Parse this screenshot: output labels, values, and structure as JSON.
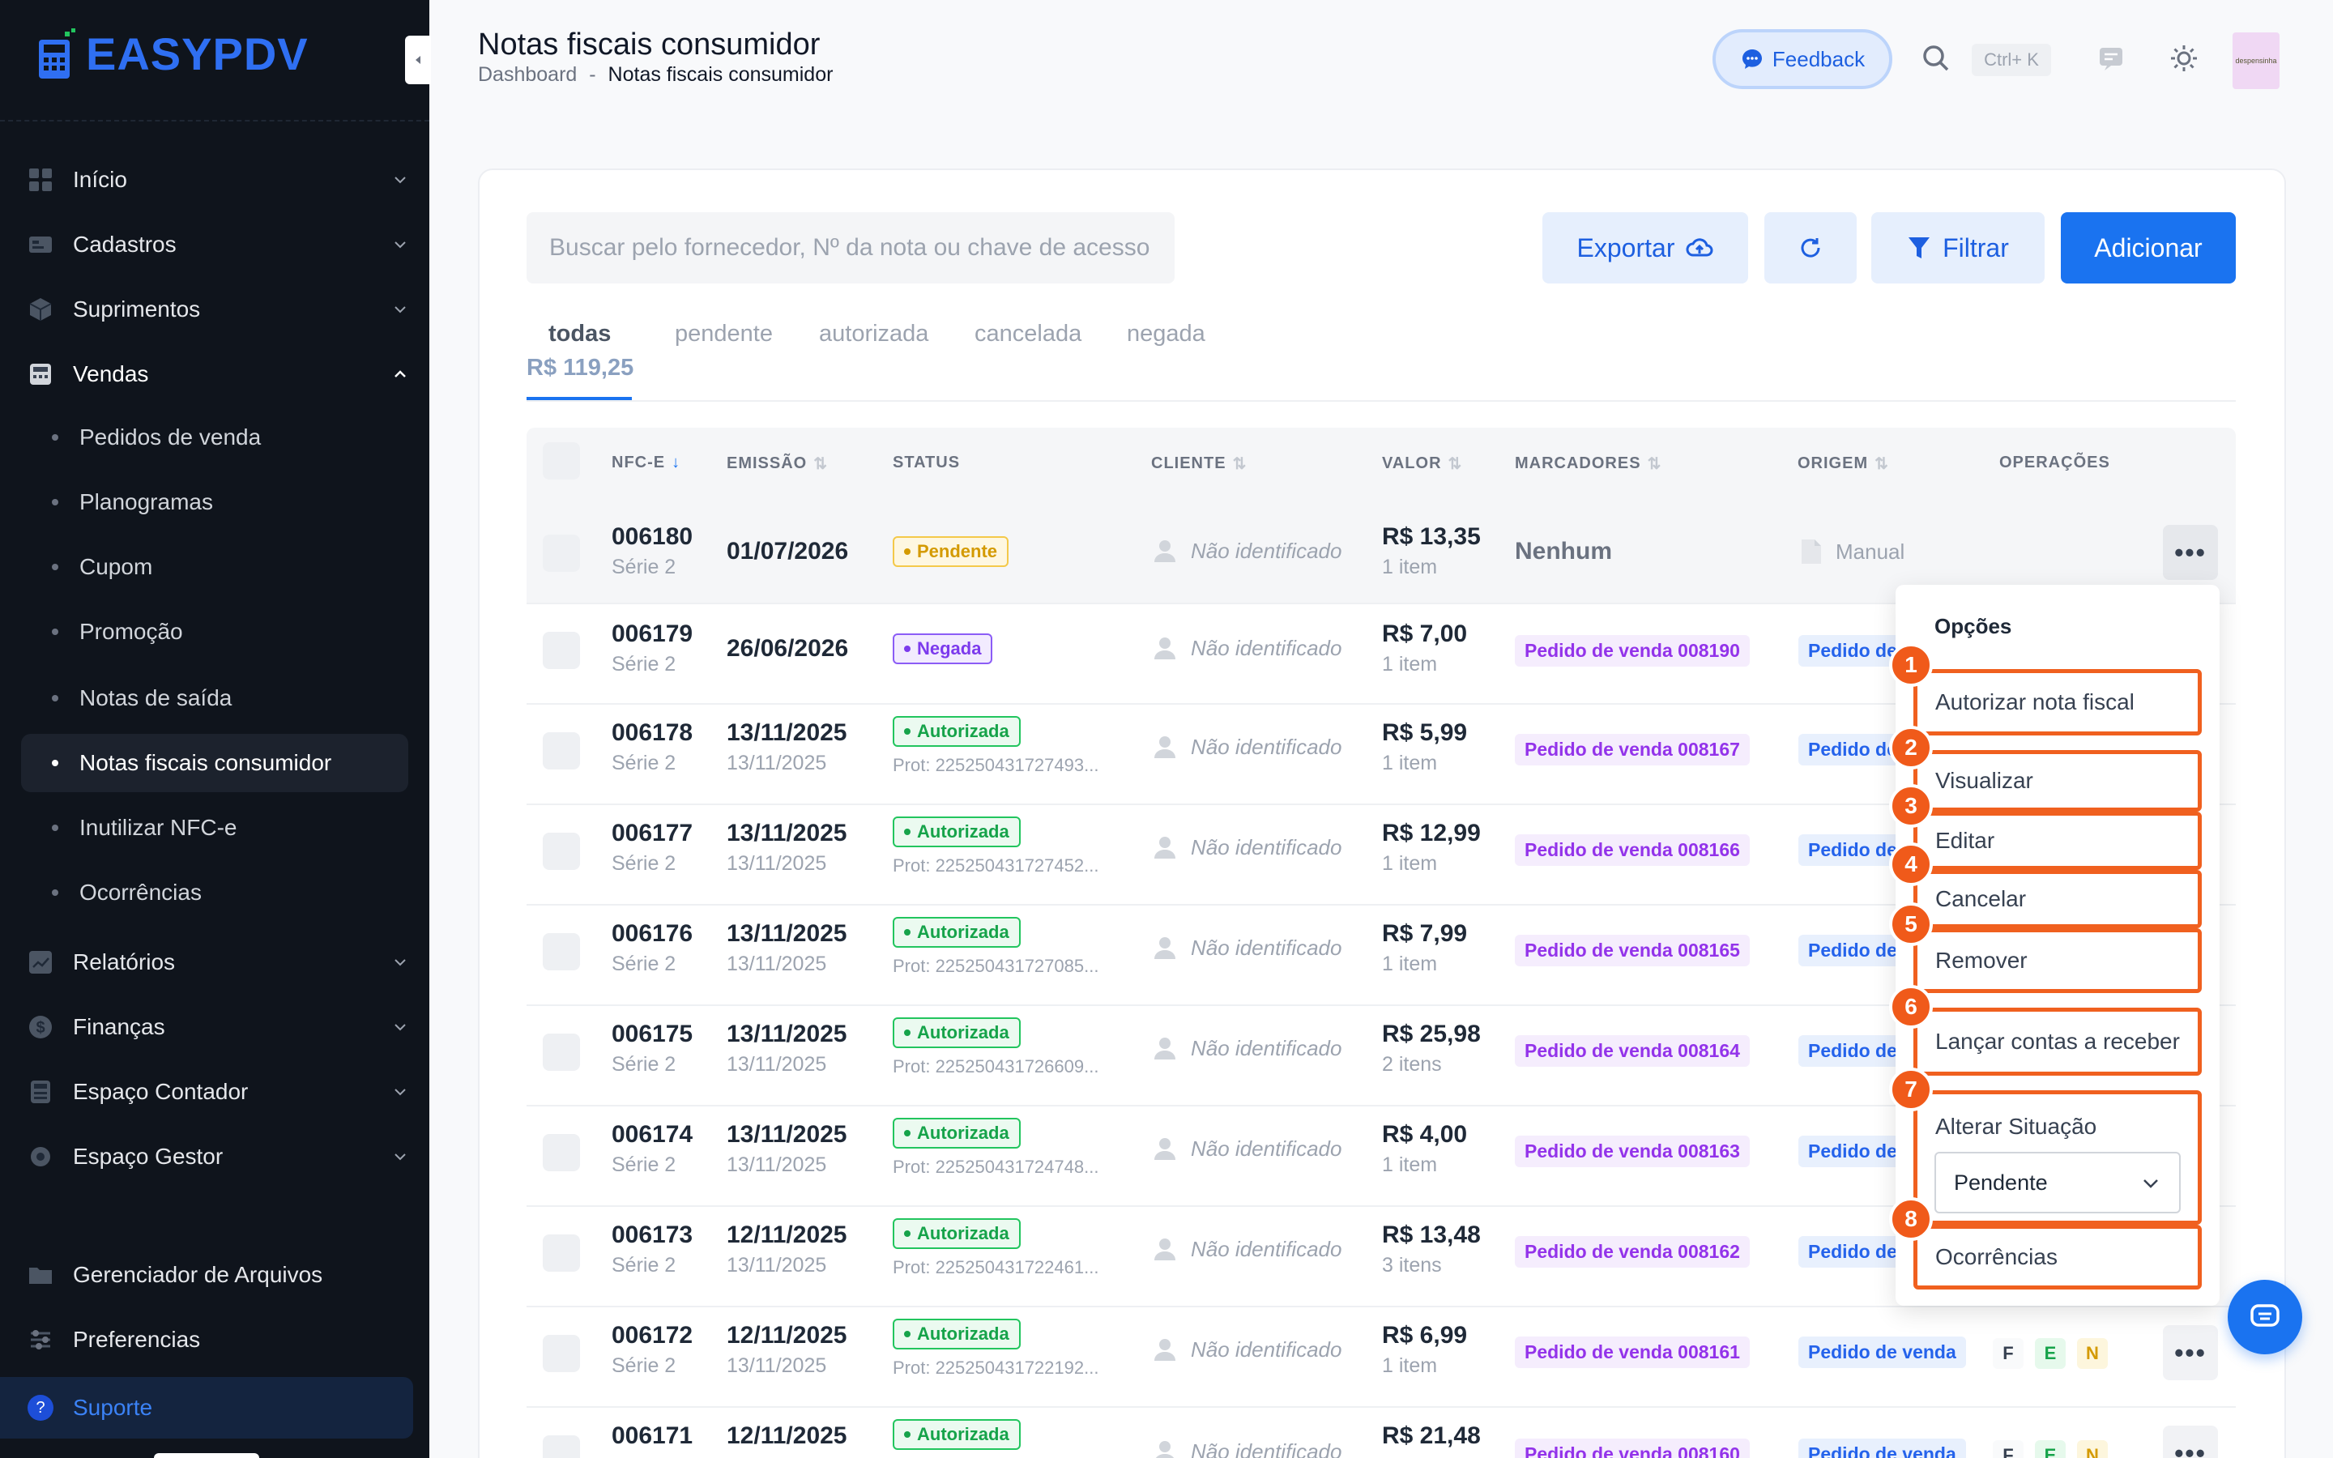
{
  "sidebar": {
    "logo_text": "EASYPDV",
    "items": [
      {
        "label": "Início",
        "icon": "home-icon"
      },
      {
        "label": "Cadastros",
        "icon": "id-card-icon"
      },
      {
        "label": "Suprimentos",
        "icon": "box-icon"
      },
      {
        "label": "Vendas",
        "icon": "register-icon"
      },
      {
        "label": "Relatórios",
        "icon": "chart-icon"
      },
      {
        "label": "Finanças",
        "icon": "dollar-icon"
      },
      {
        "label": "Espaço Contador",
        "icon": "calculator-icon"
      },
      {
        "label": "Espaço Gestor",
        "icon": "gear-icon"
      },
      {
        "label": "Gerenciador de Arquivos",
        "icon": "folder-icon"
      },
      {
        "label": "Preferencias",
        "icon": "sliders-icon"
      },
      {
        "label": "Suporte",
        "icon": "help-icon"
      }
    ],
    "sub_items": [
      "Pedidos de venda",
      "Planogramas",
      "Cupom",
      "Promoção",
      "Notas de saída",
      "Notas fiscais consumidor",
      "Inutilizar NFC-e",
      "Ocorrências"
    ]
  },
  "header": {
    "title": "Notas fiscais consumidor",
    "breadcrumb_root": "Dashboard",
    "breadcrumb_sep": "-",
    "breadcrumb_current": "Notas fiscais consumidor",
    "feedback_label": "Feedback",
    "shortcut": "Ctrl+ K",
    "avatar_text": "despensinha"
  },
  "toolbar": {
    "search_placeholder": "Buscar pelo fornecedor, Nº da nota ou chave de acesso",
    "export_label": "Exportar",
    "filter_label": "Filtrar",
    "add_label": "Adicionar"
  },
  "tabs": [
    {
      "label": "todas",
      "sum": "R$ 119,25"
    },
    {
      "label": "pendente"
    },
    {
      "label": "autorizada"
    },
    {
      "label": "cancelada"
    },
    {
      "label": "negada"
    }
  ],
  "columns": [
    "NFC-E",
    "EMISSÃO",
    "STATUS",
    "CLIENTE",
    "VALOR",
    "MARCADORES",
    "ORIGEM",
    "OPERAÇÕES"
  ],
  "rows": [
    {
      "nfce": "006180",
      "serie": "Série 2",
      "date": "01/07/2026",
      "date2": "",
      "status": "Pendente",
      "prot": "",
      "client": "Não identificado",
      "value": "R$ 13,35",
      "items": "1 item",
      "marker": "Nenhum",
      "origin": "Manual"
    },
    {
      "nfce": "006179",
      "serie": "Série 2",
      "date": "26/06/2026",
      "date2": "",
      "status": "Negada",
      "prot": "",
      "client": "Não identificado",
      "value": "R$ 7,00",
      "items": "1 item",
      "marker": "Pedido de venda 008190",
      "origin": "Pedido de venda"
    },
    {
      "nfce": "006178",
      "serie": "Série 2",
      "date": "13/11/2025",
      "date2": "13/11/2025",
      "status": "Autorizada",
      "prot": "Prot: 225250431727493...",
      "client": "Não identificado",
      "value": "R$ 5,99",
      "items": "1 item",
      "marker": "Pedido de venda 008167",
      "origin": "Pedido de venda"
    },
    {
      "nfce": "006177",
      "serie": "Série 2",
      "date": "13/11/2025",
      "date2": "13/11/2025",
      "status": "Autorizada",
      "prot": "Prot: 225250431727452...",
      "client": "Não identificado",
      "value": "R$ 12,99",
      "items": "1 item",
      "marker": "Pedido de venda 008166",
      "origin": "Pedido de venda"
    },
    {
      "nfce": "006176",
      "serie": "Série 2",
      "date": "13/11/2025",
      "date2": "13/11/2025",
      "status": "Autorizada",
      "prot": "Prot: 225250431727085...",
      "client": "Não identificado",
      "value": "R$ 7,99",
      "items": "1 item",
      "marker": "Pedido de venda 008165",
      "origin": "Pedido de venda"
    },
    {
      "nfce": "006175",
      "serie": "Série 2",
      "date": "13/11/2025",
      "date2": "13/11/2025",
      "status": "Autorizada",
      "prot": "Prot: 225250431726609...",
      "client": "Não identificado",
      "value": "R$ 25,98",
      "items": "2 itens",
      "marker": "Pedido de venda 008164",
      "origin": "Pedido de venda"
    },
    {
      "nfce": "006174",
      "serie": "Série 2",
      "date": "13/11/2025",
      "date2": "13/11/2025",
      "status": "Autorizada",
      "prot": "Prot: 225250431724748...",
      "client": "Não identificado",
      "value": "R$ 4,00",
      "items": "1 item",
      "marker": "Pedido de venda 008163",
      "origin": "Pedido de venda"
    },
    {
      "nfce": "006173",
      "serie": "Série 2",
      "date": "12/11/2025",
      "date2": "13/11/2025",
      "status": "Autorizada",
      "prot": "Prot: 225250431722461...",
      "client": "Não identificado",
      "value": "R$ 13,48",
      "items": "3 itens",
      "marker": "Pedido de venda 008162",
      "origin": "Pedido de venda"
    },
    {
      "nfce": "006172",
      "serie": "Série 2",
      "date": "12/11/2025",
      "date2": "13/11/2025",
      "status": "Autorizada",
      "prot": "Prot: 225250431722192...",
      "client": "Não identificado",
      "value": "R$ 6,99",
      "items": "1 item",
      "marker": "Pedido de venda 008161",
      "origin": "Pedido de venda"
    },
    {
      "nfce": "006171",
      "serie": "",
      "date": "12/11/2025",
      "date2": "",
      "status": "Autorizada",
      "prot": "",
      "client": "Não identificado",
      "value": "R$ 21,48",
      "items": "",
      "marker": "Pedido de venda 008160",
      "origin": "Pedido de venda"
    }
  ],
  "row_letters": [
    "F",
    "E",
    "N"
  ],
  "menu": {
    "title": "Opções",
    "items": [
      {
        "num": "1",
        "label": "Autorizar nota fiscal"
      },
      {
        "num": "2",
        "label": "Visualizar"
      },
      {
        "num": "3",
        "label": "Editar"
      },
      {
        "num": "4",
        "label": "Cancelar"
      },
      {
        "num": "5",
        "label": "Remover"
      },
      {
        "num": "6",
        "label": "Lançar contas a receber"
      },
      {
        "num": "7",
        "label": "Alterar Situação"
      },
      {
        "num": "8",
        "label": "Ocorrências"
      }
    ],
    "situation_value": "Pendente"
  },
  "colors": {
    "primary": "#1a73f0",
    "sidebar_bg": "#0f141c",
    "highlight": "#f0601f"
  }
}
